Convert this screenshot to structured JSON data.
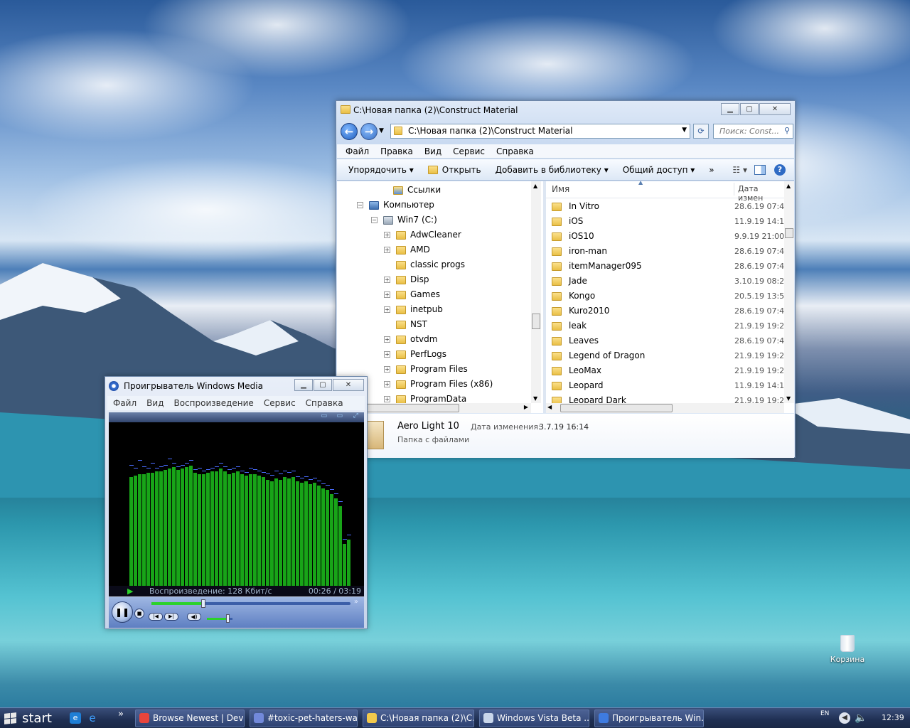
{
  "explorer": {
    "title": "C:\\Новая папка (2)\\Construct Material",
    "address": "C:\\Новая папка (2)\\Construct Material",
    "search_placeholder": "Поиск: Const...",
    "menu": [
      "Файл",
      "Правка",
      "Вид",
      "Сервис",
      "Справка"
    ],
    "commands": [
      "Упорядочить",
      "Открыть",
      "Добавить в библиотеку",
      "Общий доступ"
    ],
    "more": "»",
    "tree": [
      {
        "label": "Ссылки",
        "expander": ""
      },
      {
        "label": "Компьютер",
        "expander": "−"
      },
      {
        "label": "Win7 (C:)",
        "expander": "−"
      },
      {
        "label": "AdwCleaner",
        "expander": "+"
      },
      {
        "label": "AMD",
        "expander": "+"
      },
      {
        "label": "classic progs",
        "expander": ""
      },
      {
        "label": "Disp",
        "expander": "+"
      },
      {
        "label": "Games",
        "expander": "+"
      },
      {
        "label": "inetpub",
        "expander": "+"
      },
      {
        "label": "NST",
        "expander": ""
      },
      {
        "label": "otvdm",
        "expander": "+"
      },
      {
        "label": "PerfLogs",
        "expander": "+"
      },
      {
        "label": "Program Files",
        "expander": "+"
      },
      {
        "label": "Program Files (x86)",
        "expander": "+"
      },
      {
        "label": "ProgramData",
        "expander": "+"
      }
    ],
    "columns": {
      "name": "Имя",
      "date": "Дата измен"
    },
    "files": [
      {
        "name": "In Vitro",
        "date": "28.6.19 07:4"
      },
      {
        "name": "iOS",
        "date": "11.9.19 14:1"
      },
      {
        "name": "iOS10",
        "date": "9.9.19 21:00"
      },
      {
        "name": "iron-man",
        "date": "28.6.19 07:4"
      },
      {
        "name": "itemManager095",
        "date": "28.6.19 07:4"
      },
      {
        "name": "Jade",
        "date": "3.10.19 08:2"
      },
      {
        "name": "Kongo",
        "date": "20.5.19 13:5"
      },
      {
        "name": "Kuro2010",
        "date": "28.6.19 07:4"
      },
      {
        "name": "leak",
        "date": "21.9.19 19:2"
      },
      {
        "name": "Leaves",
        "date": "28.6.19 07:4"
      },
      {
        "name": "Legend of Dragon",
        "date": "21.9.19 19:2"
      },
      {
        "name": "LeoMax",
        "date": "21.9.19 19:2"
      },
      {
        "name": "Leopard",
        "date": "11.9.19 14:1"
      },
      {
        "name": "Leopard Dark",
        "date": "21.9.19 19:2"
      }
    ],
    "details": {
      "name": "Aero Light 10",
      "modified_label": "Дата изменения:",
      "modified": "3.7.19 16:14",
      "type": "Папка с файлами"
    }
  },
  "wmp": {
    "title": "Проигрыватель Windows Media",
    "menu": [
      "Файл",
      "Вид",
      "Воспроизведение",
      "Сервис",
      "Справка"
    ],
    "status": "Воспроизведение: 128 Кбит/с",
    "time": "00:26 / 03:19",
    "seek_position": 0.26,
    "volume": 0.8,
    "spectrum": [
      0.76,
      0.77,
      0.78,
      0.78,
      0.79,
      0.79,
      0.8,
      0.8,
      0.81,
      0.82,
      0.83,
      0.81,
      0.82,
      0.83,
      0.84,
      0.79,
      0.78,
      0.78,
      0.79,
      0.8,
      0.8,
      0.82,
      0.8,
      0.78,
      0.79,
      0.8,
      0.78,
      0.77,
      0.78,
      0.78,
      0.77,
      0.76,
      0.74,
      0.73,
      0.75,
      0.74,
      0.76,
      0.75,
      0.76,
      0.73,
      0.72,
      0.73,
      0.71,
      0.72,
      0.7,
      0.68,
      0.67,
      0.64,
      0.61,
      0.56,
      0.3,
      0.33
    ],
    "peaks": [
      0.84,
      0.82,
      0.87,
      0.83,
      0.82,
      0.85,
      0.82,
      0.83,
      0.84,
      0.88,
      0.85,
      0.83,
      0.84,
      0.85,
      0.87,
      0.81,
      0.82,
      0.8,
      0.81,
      0.82,
      0.83,
      0.85,
      0.83,
      0.81,
      0.82,
      0.83,
      0.8,
      0.79,
      0.82,
      0.81,
      0.8,
      0.79,
      0.78,
      0.77,
      0.8,
      0.78,
      0.8,
      0.79,
      0.8,
      0.76,
      0.75,
      0.76,
      0.74,
      0.75,
      0.73,
      0.71,
      0.7,
      0.67,
      0.64,
      0.59,
      0.33,
      0.36
    ]
  },
  "desktop": {
    "recycle_bin": "Корзина"
  },
  "taskbar": {
    "start": "start",
    "quicklaunch_more": "»",
    "tasks": [
      {
        "label": "Browse Newest | Devi...",
        "color": "#e8453c"
      },
      {
        "label": "#toxic-pet-haters-war...",
        "color": "#7289da"
      },
      {
        "label": "C:\\Новая папка (2)\\C...",
        "color": "#f2c94c"
      },
      {
        "label": "Windows Vista Beta ...",
        "color": "#c9d6ea"
      },
      {
        "label": "Проигрыватель Win...",
        "color": "#3e7be0"
      }
    ],
    "lang": "EN",
    "clock": "12:39"
  }
}
